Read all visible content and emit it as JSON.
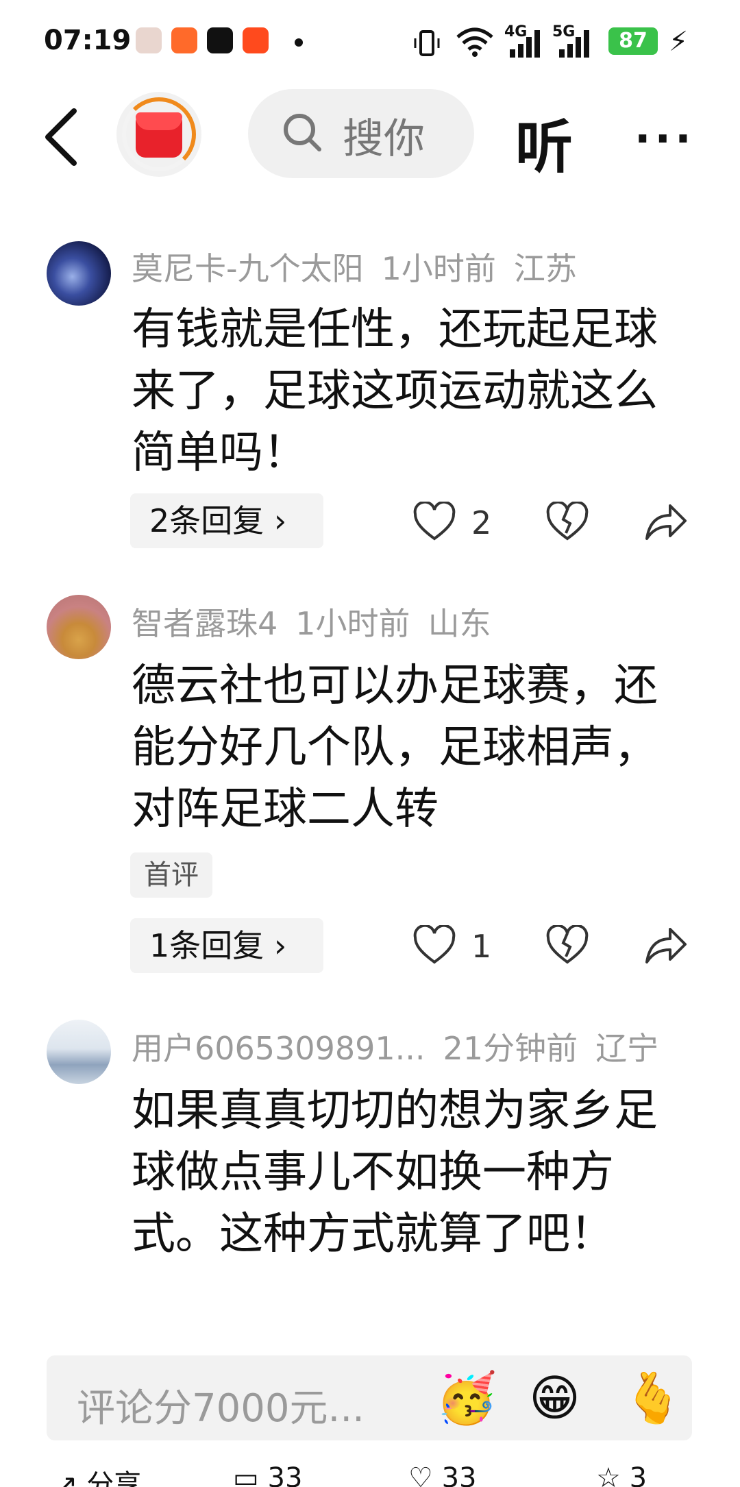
{
  "status_bar": {
    "time": "07:19",
    "net1": "4G",
    "net2": "5G",
    "battery": "87"
  },
  "top_nav": {
    "search_placeholder": "搜你",
    "listen_label": "听",
    "more_label": "···"
  },
  "comments": [
    {
      "user": "莫尼卡-九个太阳",
      "time": "1小时前",
      "location": "江苏",
      "text": "有钱就是任性，还玩起足球来了，足球这项运动就这么简单吗！",
      "tag": "",
      "replies": "2条回复",
      "likes": "2"
    },
    {
      "user": "智者露珠4",
      "time": "1小时前",
      "location": "山东",
      "text": "德云社也可以办足球赛，还能分好几个队，足球相声，对阵足球二人转",
      "tag": "首评",
      "replies": "1条回复",
      "likes": "1"
    },
    {
      "user": "用户6065309891...",
      "time": "21分钟前",
      "location": "辽宁",
      "text": "如果真真切切的想为家乡足球做点事儿不如换一种方式。这种方式就算了吧！",
      "tag": "",
      "replies": "",
      "likes": ""
    }
  ],
  "input": {
    "placeholder": "评论分7000元...",
    "emojis": [
      "🥳",
      "😁",
      "🫰"
    ]
  },
  "bottom_bar": {
    "share": "分享",
    "comments": "33",
    "likes": "33",
    "favorites": "3"
  }
}
